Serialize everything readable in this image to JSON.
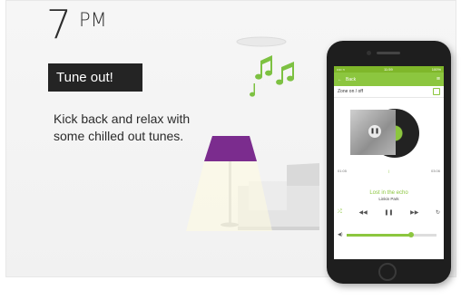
{
  "header": {
    "hour": "7",
    "period": "PM"
  },
  "tag": {
    "label": "Tune out!"
  },
  "description": {
    "line1": "Kick back and relax with",
    "line2": "some chilled out tunes."
  },
  "colors": {
    "accent_green": "#8cc63f",
    "lamp_purple": "#7b2c8e",
    "dark_label": "#242424"
  },
  "phone_app": {
    "status_left": "•••• ≈",
    "status_time": "11:59",
    "status_right": "100%",
    "appbar_back_label": "Back",
    "zone_label": "Zone on / off",
    "elapsed": "01:05",
    "duration": "03:06",
    "track_title": "Lost in the echo",
    "track_artist": "Linkin Park",
    "volume_level": 0.72
  },
  "icons": [
    "music-notes-icon",
    "back-arrow-icon",
    "menu-icon",
    "pause-icon",
    "previous-icon",
    "next-icon",
    "shuffle-icon",
    "repeat-icon",
    "volume-icon"
  ]
}
